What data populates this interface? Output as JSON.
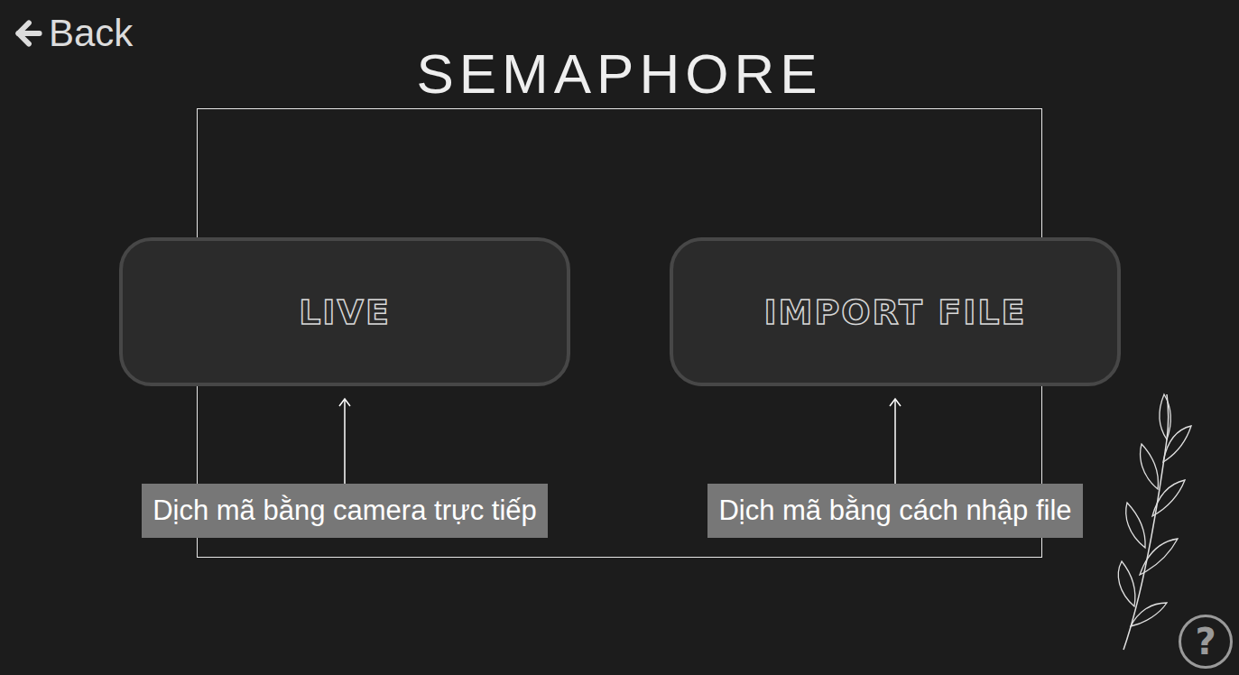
{
  "back": {
    "label": "Back"
  },
  "title": "SEMAPHORE",
  "options": [
    {
      "label": "LIVE",
      "caption": "Dịch mã bằng camera trực tiếp"
    },
    {
      "label": "IMPORT FILE",
      "caption": "Dịch mã bằng cách nhập file"
    }
  ],
  "help": {
    "label": "?"
  }
}
